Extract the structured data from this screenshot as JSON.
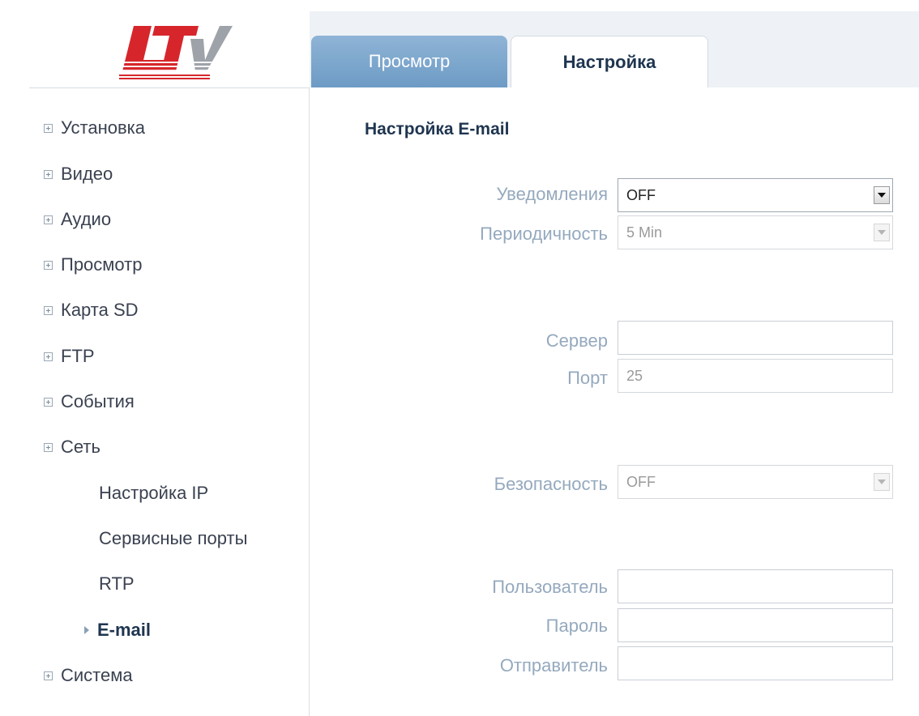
{
  "logo": {
    "text": "LTV",
    "colors": {
      "red": "#d6262b",
      "grey": "#9ea3aa"
    }
  },
  "tabs": [
    {
      "label": "Просмотр",
      "active": false
    },
    {
      "label": "Настройка",
      "active": true
    }
  ],
  "sidebar": {
    "items": [
      {
        "label": "Установка"
      },
      {
        "label": "Видео"
      },
      {
        "label": "Аудио"
      },
      {
        "label": "Просмотр"
      },
      {
        "label": "Карта SD"
      },
      {
        "label": "FTP"
      },
      {
        "label": "События"
      },
      {
        "label": "Сеть"
      },
      {
        "label": "Система"
      }
    ],
    "subitems": [
      {
        "label": "Настройка IP"
      },
      {
        "label": "Сервисные порты"
      },
      {
        "label": "RTP"
      },
      {
        "label": "E-mail",
        "active": true
      }
    ]
  },
  "main": {
    "title": "Настройка E-mail",
    "notifications": {
      "label": "Уведомления",
      "value": "OFF"
    },
    "period": {
      "label": "Периодичность",
      "value": "5 Min"
    },
    "server": {
      "label": "Сервер",
      "value": ""
    },
    "port": {
      "label": "Порт",
      "value": "25"
    },
    "security": {
      "label": "Безопасность",
      "value": "OFF"
    },
    "user": {
      "label": "Пользователь",
      "value": ""
    },
    "password": {
      "label": "Пароль",
      "value": ""
    },
    "sender": {
      "label": "Отправитель",
      "value": ""
    }
  },
  "colors": {
    "tab_inactive": "#7ba6cd",
    "label_text": "#95a9be",
    "heading_text": "#1f3550",
    "nav_text": "#3a4150"
  }
}
